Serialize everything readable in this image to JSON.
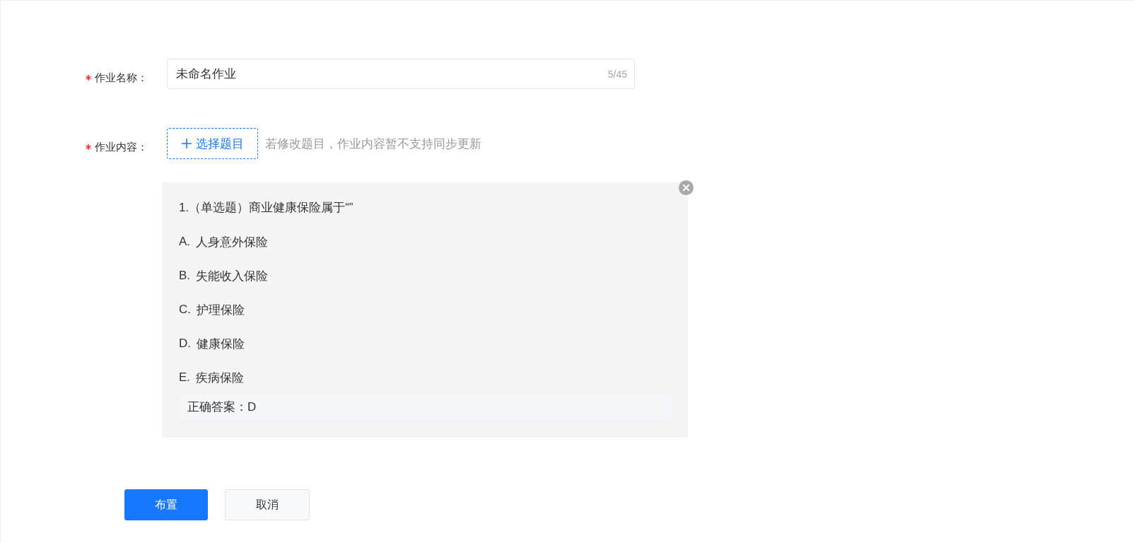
{
  "form": {
    "fields": [
      {
        "kind": "text",
        "label": "作业名称：",
        "required": true,
        "value": "未命名作业",
        "counter": "5/45"
      },
      {
        "kind": "picker",
        "label": "作业内容：",
        "required": true,
        "button": "选择题目",
        "hint": "若修改题目，作业内容暂不支持同步更新"
      }
    ]
  },
  "question": {
    "stem": "1.（单选题）商业健康保险属于“”",
    "options": [
      {
        "letter": "A.",
        "text": "人身意外保险"
      },
      {
        "letter": "B.",
        "text": "失能收入保险"
      },
      {
        "letter": "C.",
        "text": "护理保险"
      },
      {
        "letter": "D.",
        "text": "健康保险"
      },
      {
        "letter": "E.",
        "text": "疾病保险"
      }
    ],
    "answer": "正确答案：D"
  },
  "actions": [
    {
      "kind": "primary",
      "label": "布置"
    },
    {
      "kind": "default",
      "label": "取消"
    }
  ]
}
